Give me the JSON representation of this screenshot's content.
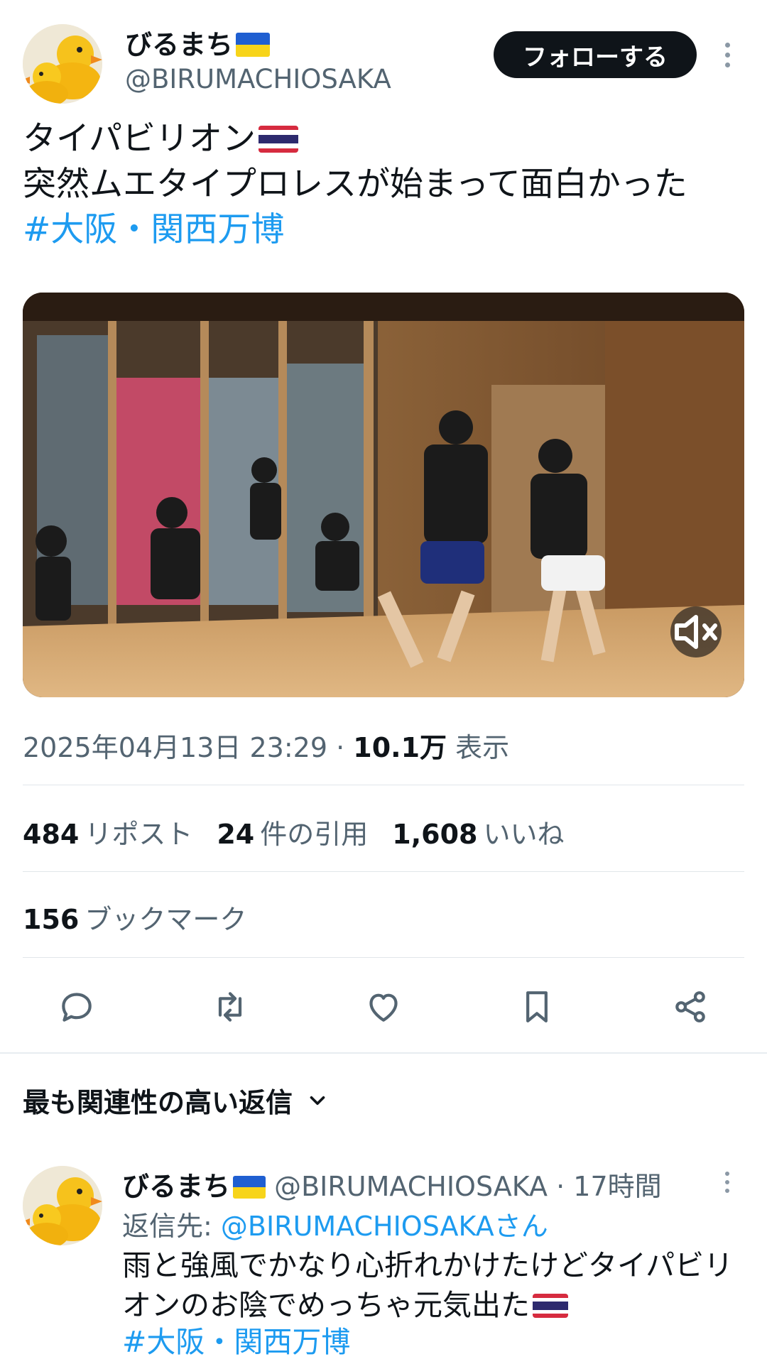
{
  "tweet": {
    "author_name": "びるまち",
    "author_handle": "@BIRUMACHIOSAKA",
    "follow_label": "フォローする",
    "text_line1": "タイパビリオン",
    "text_line2": "突然ムエタイプロレスが始まって面白かった",
    "hashtag": "#大阪・関西万博",
    "timestamp": "2025年04月13日 23:29",
    "separator": " · ",
    "views_count": "10.1万",
    "views_label": "表示"
  },
  "stats": {
    "reposts_count": "484",
    "reposts_label": "リポスト",
    "quotes_count": "24",
    "quotes_label": "件の引用",
    "likes_count": "1,608",
    "likes_label": "いいね",
    "bookmarks_count": "156",
    "bookmarks_label": "ブックマーク"
  },
  "actions": [
    "reply-icon",
    "repost-icon",
    "like-icon",
    "bookmark-icon",
    "share-icon"
  ],
  "replies": {
    "header": "最も関連性の高い返信",
    "items": [
      {
        "author_name": "びるまち",
        "author_handle": "@BIRUMACHIOSAKA",
        "time": "17時間",
        "reply_to_prefix": "返信先: ",
        "reply_to_handle": "@BIRUMACHIOSAKAさん",
        "text_line1": "雨と強風でかなり心折れかけたけどタイパビリ",
        "text_line2": "オンのお陰でめっちゃ元気出た",
        "hashtag": "#大阪・関西万博"
      }
    ]
  },
  "colors": {
    "accent": "#1d9bf0",
    "text": "#0f1419",
    "secondary": "#536471",
    "ukraine_blue": "#1f5fd1",
    "ukraine_yellow": "#f7d41a",
    "thai_red": "#d62b3f",
    "thai_blue": "#2d2a6e"
  }
}
